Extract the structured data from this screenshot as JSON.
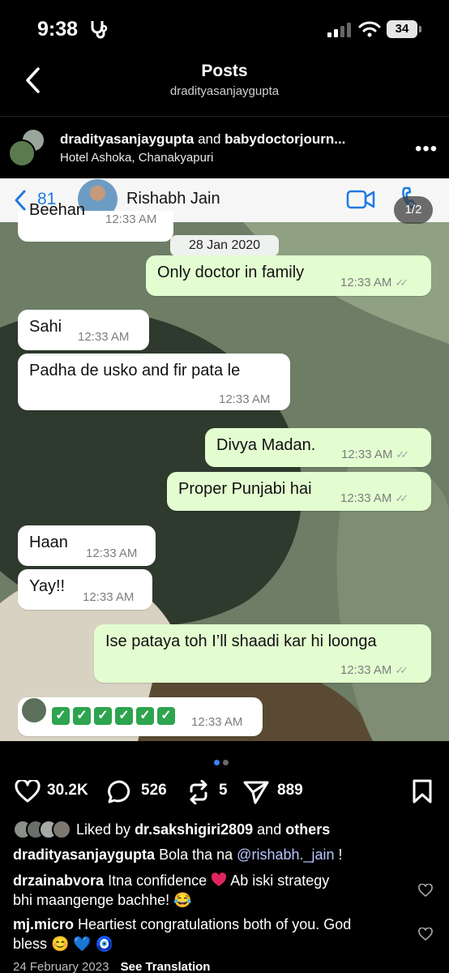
{
  "status_bar": {
    "time": "9:38",
    "battery": "34"
  },
  "header": {
    "title": "Posts",
    "username": "dradityasanjaygupta"
  },
  "post": {
    "author": "dradityasanjaygupta",
    "and_text": "and",
    "collaborator": "babydoctorjourn...",
    "location": "Hotel Ashoka, Chanakyapuri"
  },
  "chat_screenshot": {
    "back_count": "81",
    "contact_name": "Rishabh Jain",
    "page_indicator": "1/2",
    "cut_message": {
      "text": "Beehan",
      "time": "12:33 AM"
    },
    "date_chip": "28 Jan 2020",
    "messages": [
      {
        "direction": "out",
        "text": "Only doctor in family",
        "time": "12:33 AM"
      },
      {
        "direction": "in",
        "text": "Sahi",
        "time": "12:33 AM"
      },
      {
        "direction": "in",
        "text": "Padha de usko and fir pata le",
        "time": "12:33 AM"
      },
      {
        "direction": "out",
        "text": "Divya Madan.",
        "time": "12:33 AM"
      },
      {
        "direction": "out",
        "text": "Proper Punjabi hai",
        "time": "12:33 AM"
      },
      {
        "direction": "in",
        "text": "Haan",
        "time": "12:33 AM"
      },
      {
        "direction": "in",
        "text": "Yay!!",
        "time": "12:33 AM"
      },
      {
        "direction": "out",
        "text": "Ise pataya toh I’ll shaadi kar hi loonga",
        "time": "12:33 AM"
      },
      {
        "direction": "in",
        "text": "✅✅✅✅✅✅✅",
        "time": "12:33 AM"
      }
    ]
  },
  "carousel": {
    "current": 1,
    "total": 2
  },
  "actions": {
    "likes": "30.2K",
    "comments": "526",
    "reposts": "5",
    "shares": "889"
  },
  "liked_by": {
    "prefix": "Liked by",
    "user": "dr.sakshigiri2809",
    "middle": "and",
    "suffix": "others"
  },
  "caption": {
    "user": "dradityasanjaygupta",
    "text": "Bola tha na",
    "mention": "@rishabh._jain",
    "end": "!"
  },
  "comments": [
    {
      "user": "drzainabvora",
      "line1": "Itna confidence",
      "line1_end": "Ab iski strategy",
      "line2": "bhi maangenge bachhe! 😂"
    },
    {
      "user": "mj.micro",
      "line1": "Heartiest congratulations both of you. God",
      "line2": "bless 😊 💙 🧿"
    }
  ],
  "footer": {
    "date": "24 February 2023",
    "translate": "See Translation"
  },
  "colors": {
    "chat_bg": "#5d6b56",
    "outgoing_bubble": "#e3fdd0",
    "whatsapp_blue": "#1f7ae0",
    "heart_red": "#e0245e"
  }
}
